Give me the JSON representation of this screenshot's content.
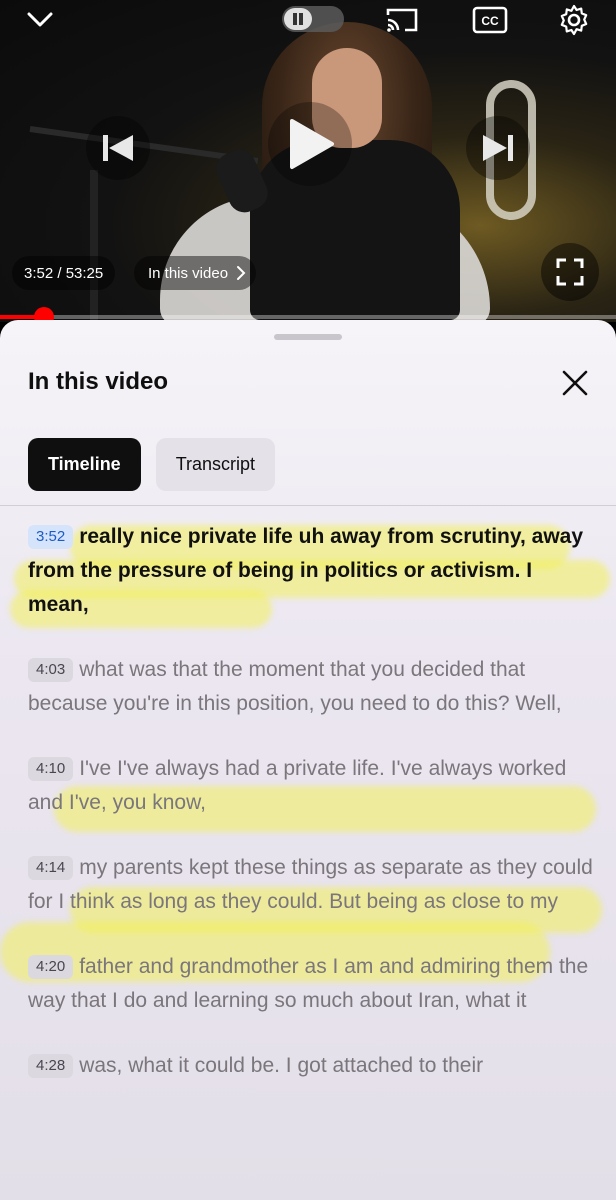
{
  "player": {
    "elapsed": "3:52",
    "duration": "53:25",
    "time_display": "3:52 / 53:25",
    "chapter_label": "In this video",
    "progress": 0.072,
    "accent": "#ff0000",
    "icons": {
      "collapse": "chevron-down-icon",
      "autoplay": "pause-toggle-icon",
      "cast": "cast-icon",
      "captions": "cc-icon",
      "settings": "gear-icon",
      "previous": "skip-previous-icon",
      "play": "play-icon",
      "next": "skip-next-icon",
      "fullscreen": "fullscreen-icon"
    },
    "cc_label": "CC"
  },
  "sheet": {
    "title": "In this video",
    "close_icon": "close-icon",
    "tabs": [
      {
        "label": "Timeline",
        "active": true
      },
      {
        "label": "Transcript",
        "active": false
      }
    ]
  },
  "transcript": [
    {
      "time": "3:52",
      "text": "really nice private life uh away from scrutiny, away from the pressure of being in politics or activism. I mean,",
      "current": true
    },
    {
      "time": "4:03",
      "text": "what was that the moment that you decided that because you're in this position, you need to do this? Well,",
      "current": false
    },
    {
      "time": "4:10",
      "text": "I've I've always had a private life. I've always worked and I've, you know,",
      "current": false
    },
    {
      "time": "4:14",
      "text": "my parents kept these things as separate as they could for I think as long as they could. But being as close to my",
      "current": false
    },
    {
      "time": "4:20",
      "text": "father and grandmother as I am and admiring them the way that I do and learning so much about Iran, what it",
      "current": false
    },
    {
      "time": "4:28",
      "text": "was, what it could be. I got attached to their",
      "current": false
    }
  ],
  "colors": {
    "sheet_bg": "#f6f4f8",
    "highlight": "#f3f05a",
    "current_timestamp": "#1b5cc6"
  }
}
